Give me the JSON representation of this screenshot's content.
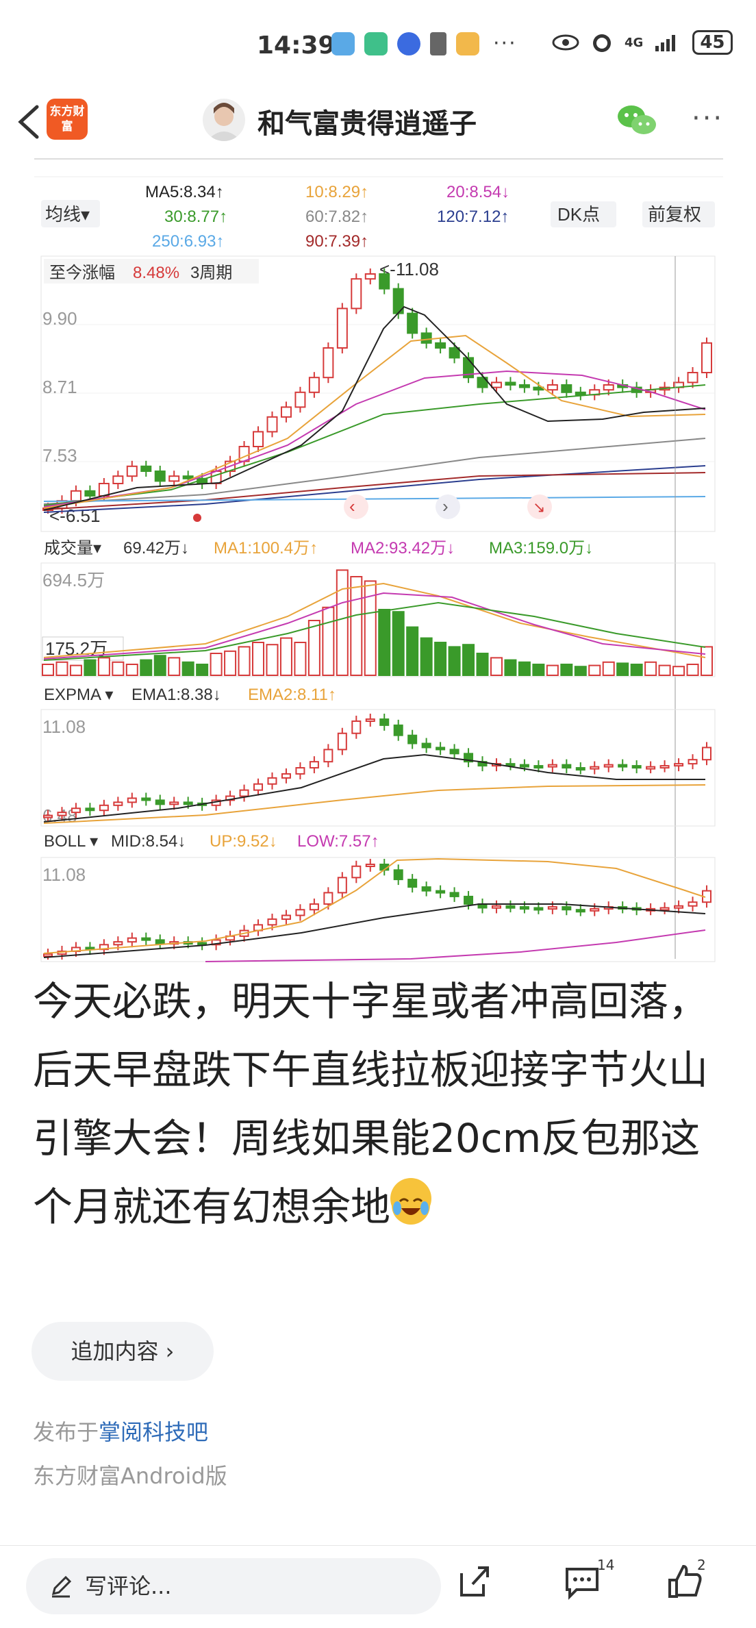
{
  "status_bar": {
    "time": "14:39",
    "more": "···",
    "network": "4G",
    "battery": "45"
  },
  "header": {
    "app_logo_text": "东方财富",
    "username": "和气富贵得逍遥子",
    "more": "···"
  },
  "chart_panel": {
    "ma_toggle": "均线▾",
    "ma5": "MA5:8.34↑",
    "ma10": "10:8.29↑",
    "ma20": "20:8.54↓",
    "ma30": "30:8.77↑",
    "ma60": "60:7.82↑",
    "ma120": "120:7.12↑",
    "ma250": "250:6.93↑",
    "ma90": "90:7.39↑",
    "dk_button": "DK点",
    "adjust_button": "前复权",
    "gain_label": "至今涨幅",
    "gain_value": "8.48%",
    "gain_period": "3周期",
    "max_price": "11.08",
    "min_price": "6.51",
    "price_ticks": [
      "9.90",
      "8.71",
      "7.53"
    ],
    "vol_toggle": "成交量▾",
    "vol_value": "69.42万↓",
    "vol_ma1": "MA1:100.4万↑",
    "vol_ma2": "MA2:93.42万↓",
    "vol_ma3": "MA3:159.0万↓",
    "vol_top_tick": "694.5万",
    "vol_marker": "175.2万",
    "expma_toggle": "EXPMA ▾",
    "ema1": "EMA1:8.38↓",
    "ema2": "EMA2:8.11↑",
    "expma_top": "11.08",
    "expma_bottom": "6.48",
    "boll_toggle": "BOLL ▾",
    "boll_mid": "MID:8.54↓",
    "boll_up": "UP:9.52↓",
    "boll_low": "LOW:7.57↑",
    "boll_top": "11.08"
  },
  "colors": {
    "up": "#d63a3a",
    "down": "#3a9a2a",
    "ma5": "#222222",
    "ma10": "#e8a33a",
    "ma20": "#c43ab0",
    "ma30": "#3a9a2a",
    "ma60": "#888888",
    "ma120": "#2b3e8f",
    "ma250": "#5aa9e6",
    "ma90": "#a32a2a",
    "link": "#2e6bb8"
  },
  "post": {
    "text": "今天必跌，明天十字星或者冲高回落，后天早盘跌下午直线拉板迎接字节火山引擎大会！周线如果能20cm反包那这个月就还有幻想余地",
    "emoji": "crying-laughing-emoji"
  },
  "add_content_button": "追加内容 ›",
  "publish": {
    "prefix": "发布于",
    "bar_name": "掌阅科技吧"
  },
  "client": "东方财富Android版",
  "bottom_bar": {
    "comment_placeholder": "写评论...",
    "comment_count": "14",
    "like_count": "2"
  }
}
